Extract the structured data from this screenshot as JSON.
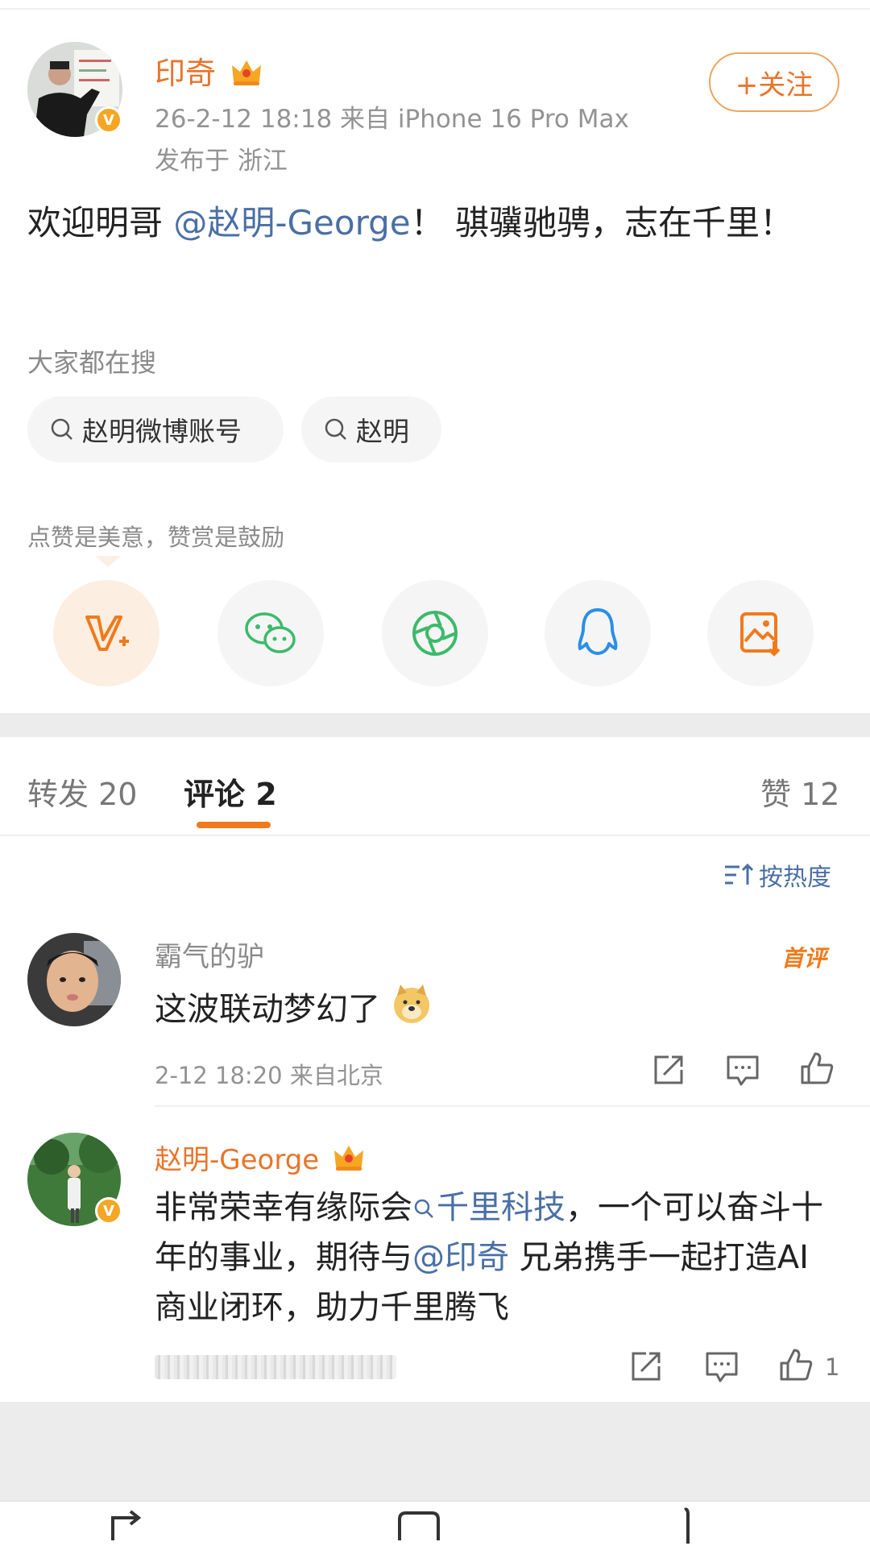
{
  "post": {
    "author": "印奇",
    "meta": "26-2-12 18:18  来自 iPhone 16 Pro Max",
    "location": "发布于 浙江",
    "follow_label": "+关注",
    "text_before": "欢迎明哥 ",
    "mention": "@赵明-George",
    "text_after": "！ 骐骥驰骋，志在千里！"
  },
  "search": {
    "title": "大家都在搜",
    "chips": [
      "赵明微博账号",
      "赵明"
    ]
  },
  "praise_hint": "点赞是美意，赞赏是鼓励",
  "share_icons": [
    "v-plus-icon",
    "wechat-icon",
    "moments-icon",
    "qq-icon",
    "save-image-icon"
  ],
  "tabs": {
    "repost": "转发 20",
    "comment": "评论 2",
    "like": "赞 12"
  },
  "sort_label": "按热度",
  "comments": [
    {
      "name": "霸气的驴",
      "text": "这波联动梦幻了",
      "meta": "2-12 18:20 来自北京",
      "badge": "首评",
      "likes": ""
    },
    {
      "name": "赵明-George",
      "text_before": "非常荣幸有缘际会",
      "topic": "千里科技",
      "text_mid": "，一个可以奋斗十年的事业，期待与",
      "mention": "@印奇",
      "text_after": " 兄弟携手一起打造AI商业闭环，助力千里腾飞",
      "likes": "1"
    }
  ],
  "colors": {
    "accent_orange": "#e8742a",
    "link_blue": "#4a6fa5",
    "muted_gray": "#939393"
  }
}
